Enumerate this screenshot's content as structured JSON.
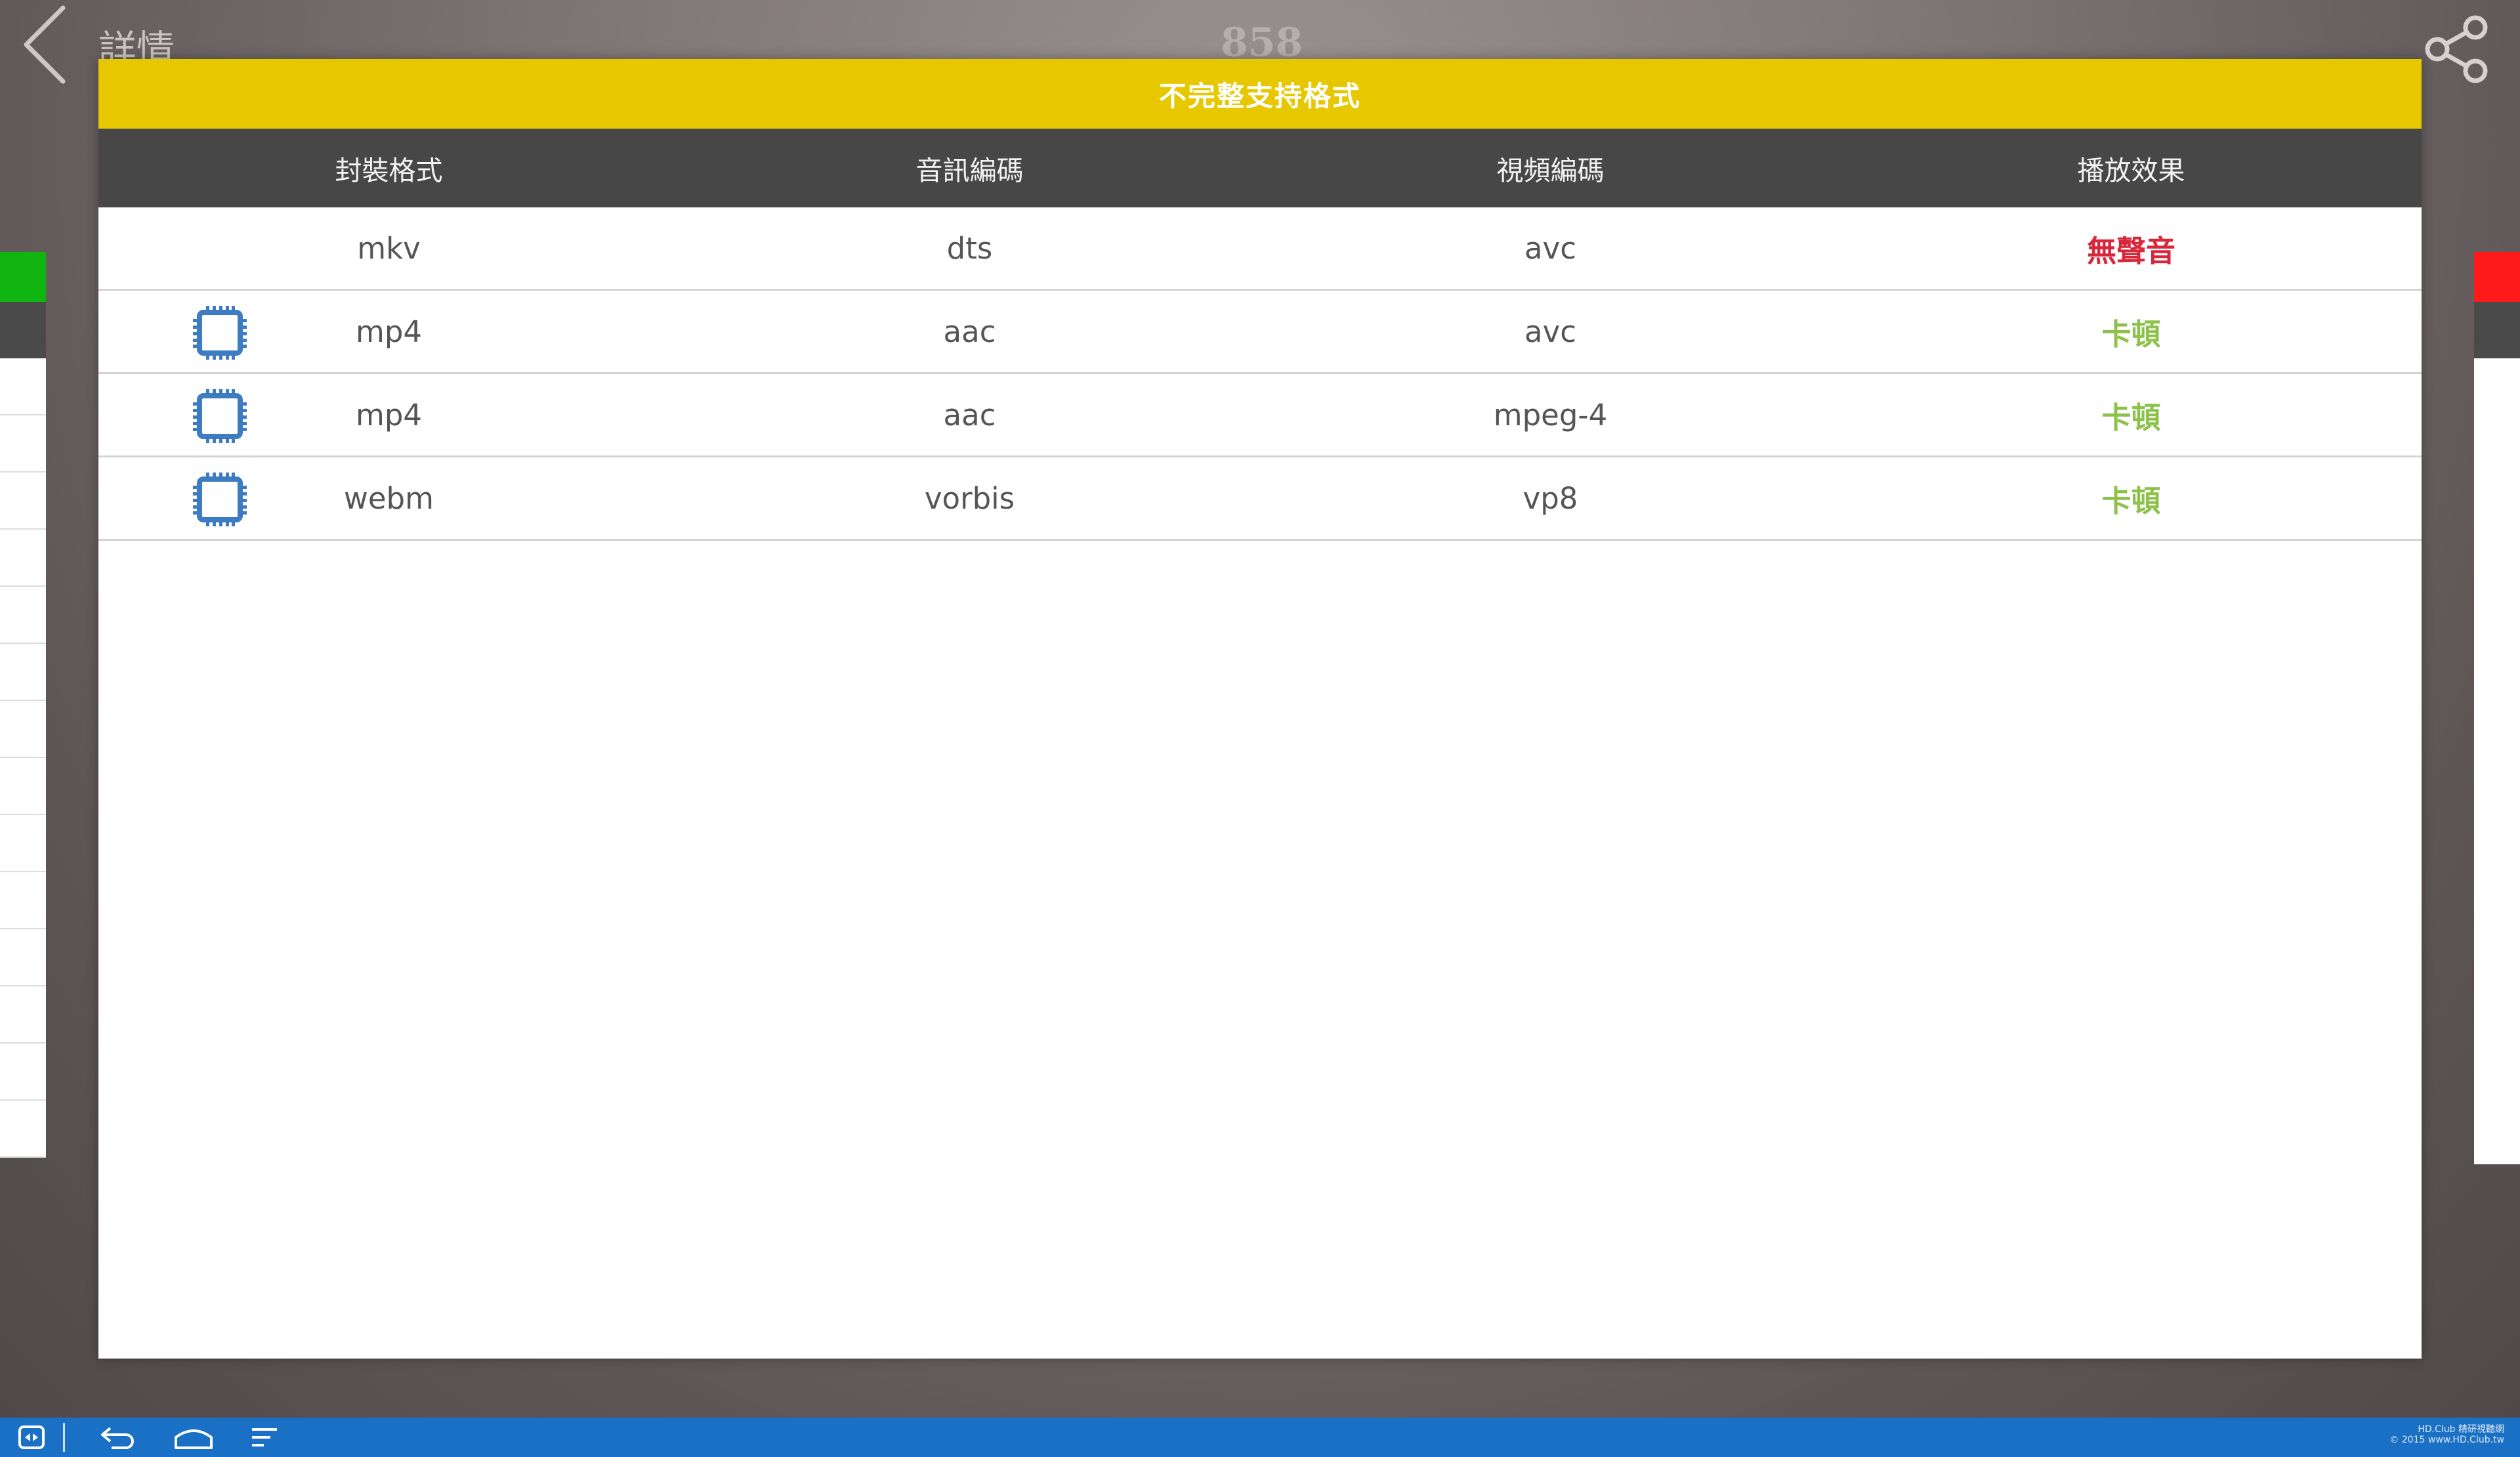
{
  "topbar": {
    "title": "詳情",
    "score": "858"
  },
  "dialog": {
    "title": "不完整支持格式",
    "columns": [
      "封裝格式",
      "音訊編碼",
      "視頻編碼",
      "播放效果"
    ],
    "rows": [
      {
        "container": "mkv",
        "audio": "dts",
        "video": "avc",
        "result": "無聲音",
        "hw_icon": false,
        "result_color": "#d8263a"
      },
      {
        "container": "mp4",
        "audio": "aac",
        "video": "avc",
        "result": "卡頓",
        "hw_icon": true,
        "result_color": "#8cc24a"
      },
      {
        "container": "mp4",
        "audio": "aac",
        "video": "mpeg-4",
        "result": "卡頓",
        "hw_icon": true,
        "result_color": "#8cc24a"
      },
      {
        "container": "webm",
        "audio": "vorbis",
        "video": "vp8",
        "result": "卡頓",
        "hw_icon": true,
        "result_color": "#8cc24a"
      }
    ]
  },
  "side_indicators": {
    "left_color": "#11b50f",
    "right_color": "#ff1a1a"
  },
  "navbar": {
    "watermark_line1": "HD.Club 精研視聽網",
    "watermark_line2": "© 2015 www.HD.Club.tw"
  },
  "colors": {
    "header_yellow": "#e7c800",
    "table_head": "#474747",
    "navbar_blue": "#1a70c4"
  }
}
